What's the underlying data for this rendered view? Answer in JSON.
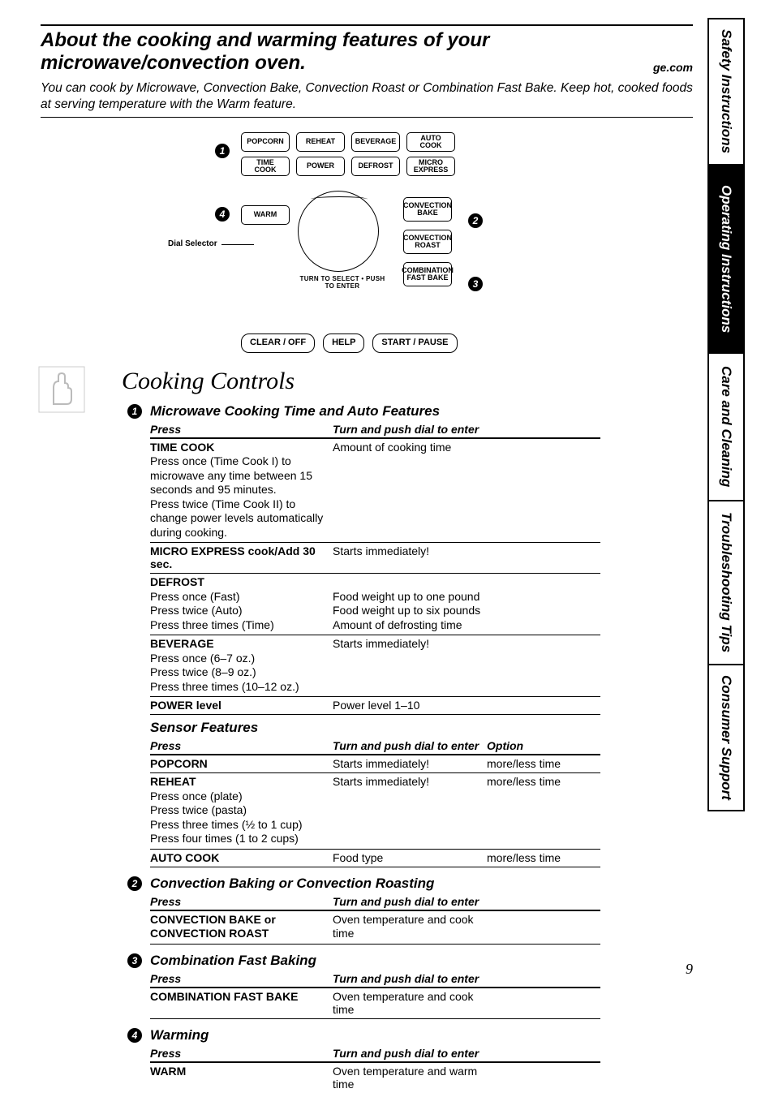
{
  "header": {
    "title_line1": "About the cooking and warming features of your",
    "title_line2": "microwave/convection oven.",
    "url": "ge.com",
    "intro": "You can cook by Microwave, Convection Bake, Convection Roast or Combination Fast Bake. Keep hot, cooked foods at serving temperature with the Warm feature."
  },
  "panel": {
    "row1": [
      "POPCORN",
      "REHEAT",
      "BEVERAGE",
      "AUTO\nCOOK"
    ],
    "row2": [
      "TIME\nCOOK",
      "POWER",
      "DEFROST",
      "MICRO\nEXPRESS"
    ],
    "warm": "WARM",
    "side": [
      "CONVECTION\nBAKE",
      "CONVECTION\nROAST",
      "COMBINATION\nFAST BAKE"
    ],
    "dial_label": "Dial Selector",
    "dial_caption": "TURN TO SELECT • PUSH TO ENTER",
    "bottom": [
      "CLEAR / OFF",
      "HELP",
      "START / PAUSE"
    ],
    "circ": {
      "1": "1",
      "2": "2",
      "3": "3",
      "4": "4"
    }
  },
  "section_title": "Cooking Controls",
  "sections": {
    "s1": {
      "num": "1",
      "title": "Microwave Cooking Time and Auto Features",
      "hdr": {
        "a": "Press",
        "b": "Turn and push dial to enter"
      },
      "rows": [
        {
          "a_lbl": "TIME COOK",
          "a_sub": "Press once (Time Cook I) to microwave any time between 15 seconds and 95 minutes.\nPress twice (Time Cook II) to change power levels automatically during cooking.",
          "b": "Amount of cooking time"
        },
        {
          "a_lbl": "MICRO EXPRESS cook/Add 30 sec.",
          "b": "Starts immediately!"
        },
        {
          "a_lbl": "DEFROST",
          "a_sub": "Press once (Fast)\nPress twice (Auto)\nPress three times (Time)",
          "b": "\nFood weight up to one pound\nFood weight up to six pounds\nAmount of defrosting time"
        },
        {
          "a_lbl": "BEVERAGE",
          "a_sub": "Press once (6–7 oz.)\nPress twice (8–9 oz.)\nPress three times (10–12 oz.)",
          "b": "Starts immediately!"
        },
        {
          "a_lbl": "POWER level",
          "b": "Power level 1–10"
        }
      ]
    },
    "sensor": {
      "title": "Sensor Features",
      "hdr": {
        "a": "Press",
        "b": "Turn and push dial to enter",
        "c": "Option"
      },
      "rows": [
        {
          "a_lbl": "POPCORN",
          "b": "Starts immediately!",
          "c": "more/less time"
        },
        {
          "a_lbl": "REHEAT",
          "a_sub": "Press once (plate)\nPress twice (pasta)\nPress three times (½ to 1 cup)\nPress four times (1 to 2 cups)",
          "b": "Starts immediately!",
          "c": "more/less time"
        },
        {
          "a_lbl": "AUTO COOK",
          "b": "Food type",
          "c": "more/less time"
        }
      ]
    },
    "s2": {
      "num": "2",
      "title": "Convection Baking or Convection Roasting",
      "hdr": {
        "a": "Press",
        "b": "Turn and push dial to enter"
      },
      "rows": [
        {
          "a_lbl": "CONVECTION BAKE or CONVECTION ROAST",
          "b": "Oven temperature and cook time"
        }
      ]
    },
    "s3": {
      "num": "3",
      "title": "Combination Fast Baking",
      "hdr": {
        "a": "Press",
        "b": "Turn and push dial to enter"
      },
      "rows": [
        {
          "a_lbl": "COMBINATION FAST BAKE",
          "b": "Oven temperature and cook time"
        }
      ]
    },
    "s4": {
      "num": "4",
      "title": "Warming",
      "hdr": {
        "a": "Press",
        "b": "Turn and push dial to enter"
      },
      "rows": [
        {
          "a_lbl": "WARM",
          "b": "Oven temperature and warm time"
        }
      ]
    }
  },
  "tabs": [
    "Safety Instructions",
    "Operating Instructions",
    "Care and Cleaning",
    "Troubleshooting Tips",
    "Consumer Support"
  ],
  "active_tab": 1,
  "page_number": "9"
}
